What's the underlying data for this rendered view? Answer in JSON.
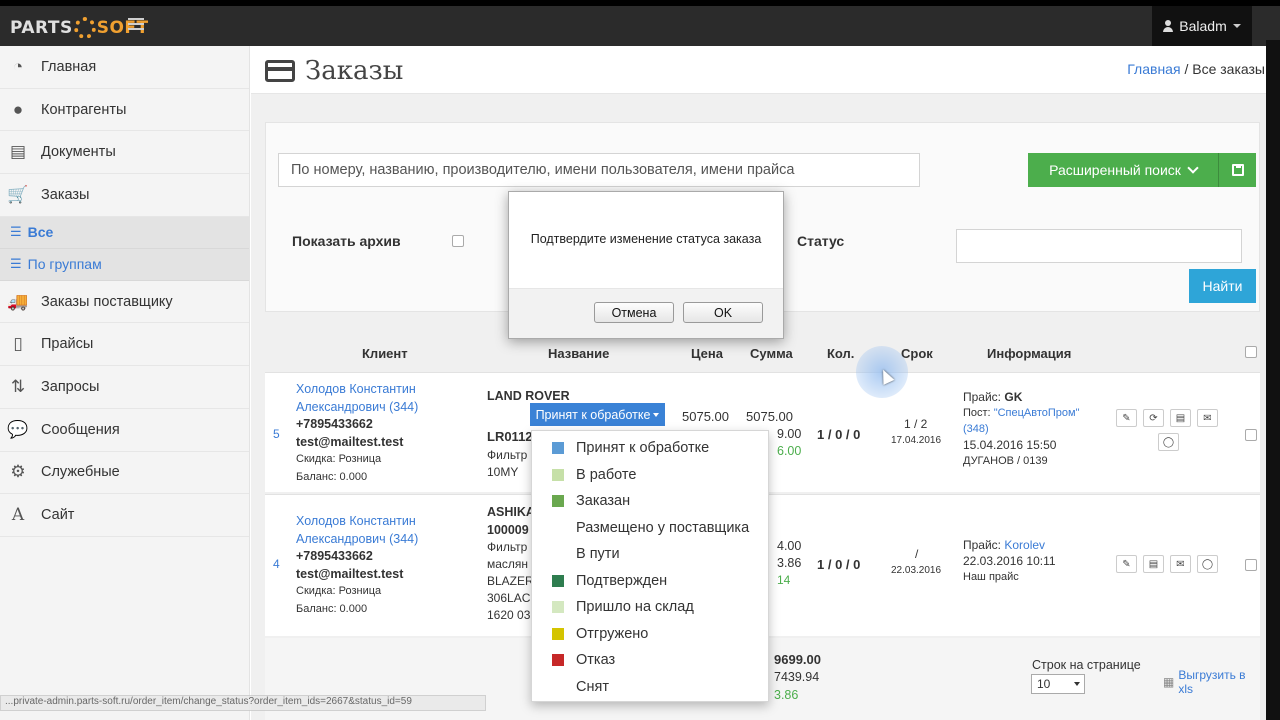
{
  "logo": {
    "part1": "PARTS",
    "part2": "SOFT"
  },
  "user": {
    "name": "Baladm"
  },
  "sidebar": {
    "items": [
      {
        "label": "Главная"
      },
      {
        "label": "Контрагенты"
      },
      {
        "label": "Документы"
      },
      {
        "label": "Заказы"
      }
    ],
    "subitems": [
      {
        "label": "Все"
      },
      {
        "label": "По группам"
      }
    ],
    "items2": [
      {
        "label": "Заказы поставщику"
      },
      {
        "label": "Прайсы"
      },
      {
        "label": "Запросы"
      },
      {
        "label": "Сообщения"
      },
      {
        "label": "Служебные"
      },
      {
        "label": "Сайт"
      }
    ]
  },
  "page": {
    "title": "Заказы",
    "breadcrumb_home": "Главная",
    "breadcrumb_current": "/ Все заказы"
  },
  "filter": {
    "search_placeholder": "По номеру, названию, производителю, имени пользователя, имени прайса",
    "advanced_label": "Расширенный поиск",
    "archive_label": "Показать архив",
    "status_label": "Статус",
    "find_label": "Найти"
  },
  "table": {
    "headers": {
      "client": "Клиент",
      "name": "Название",
      "price": "Цена",
      "sum": "Сумма",
      "qty": "Кол.",
      "term": "Срок",
      "info": "Информация"
    },
    "rows": [
      {
        "num": "5",
        "client_name1": "Холодов Константин",
        "client_name2": "Александрович (344)",
        "phone": "+7895433662",
        "email": "test@mailtest.test",
        "discount": "Скидка: Розница",
        "balance": "Баланс: 0.000",
        "brand": "LAND ROVER",
        "article": "LR0112",
        "desc1": "Фильтр",
        "desc2": "10MY",
        "price": "5075.00",
        "sum": "5075.00",
        "sum2": "9.00",
        "sum3": "6.00",
        "qty": "1 / 0 / 0",
        "term": "1 / 2",
        "term_date": "17.04.2016",
        "info_price_label": "Прайс:",
        "info_price": "GK",
        "info_supplier_label": "Пост:",
        "info_supplier": "\"СпецАвтоПром\" (348)",
        "info_date": "15.04.2016 15:50",
        "info_note": "ДУГАНОВ / 0139"
      },
      {
        "num": "4",
        "client_name1": "Холодов Константин",
        "client_name2": "Александрович (344)",
        "phone": "+7895433662",
        "email": "test@mailtest.test",
        "discount": "Скидка: Розница",
        "balance": "Баланс: 0.000",
        "brand": "ASHIKA",
        "article": "100009",
        "desc1": "Фильтр",
        "desc2": "маслян",
        "desc3": "BLAZER",
        "desc4": "306LAC",
        "desc5": "1620 03",
        "sum": "4.00",
        "sum2": "3.86",
        "sum3": "14",
        "qty": "1 / 0 / 0",
        "term": "/",
        "term_date": "22.03.2016",
        "info_price_label": "Прайс:",
        "info_price": "Korolev",
        "info_date": "22.03.2016 10:11",
        "info_note": "Наш прайс"
      }
    ]
  },
  "footer": {
    "total1": "9699.00",
    "total2": "7439.94",
    "total3": "3.86",
    "per_page_label": "Строк на странице",
    "per_page_value": "10",
    "export_label": "Выгрузить в xls"
  },
  "dialog": {
    "message": "Подтвердите изменение статуса заказа",
    "cancel": "Отмена",
    "ok": "OK"
  },
  "status_dropdown": {
    "current": "Принят к обработке",
    "options": [
      {
        "label": "Принят к обработке",
        "color": "#5b9bd5"
      },
      {
        "label": "В работе",
        "color": "#c6e0a8"
      },
      {
        "label": "Заказан",
        "color": "#6aa84f"
      },
      {
        "label": "Размещено у поставщика",
        "color": ""
      },
      {
        "label": "В пути",
        "color": ""
      },
      {
        "label": "Подтвержден",
        "color": "#2e7d4f"
      },
      {
        "label": "Пришло на склад",
        "color": "#d4e8c0"
      },
      {
        "label": "Отгружено",
        "color": "#d4c400"
      },
      {
        "label": "Отказ",
        "color": "#c62828"
      },
      {
        "label": "Снят",
        "color": ""
      }
    ]
  },
  "statusbar": {
    "url": "...private-admin.parts-soft.ru/order_item/change_status?order_item_ids=2667&status_id=59"
  }
}
